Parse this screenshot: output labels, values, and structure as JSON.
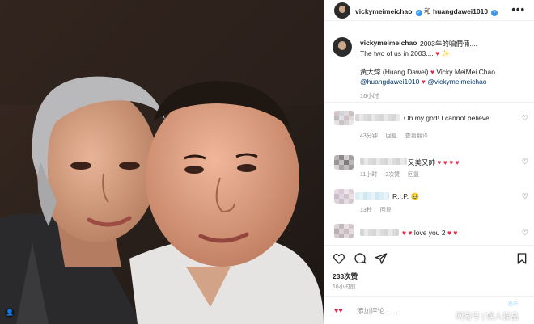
{
  "header": {
    "user1": "vickymeimeichao",
    "conjunction": "和",
    "user2": "huangdawei1010",
    "verified_badge": "✓",
    "more_icon": "more-horizontal-icon",
    "more_glyph": "•••"
  },
  "caption": {
    "username": "vickymeimeichao",
    "text_line1": "2003年的咱們倆....",
    "text_line2": "The two of us in 2003....",
    "heart": "♥",
    "sparkle": "✨",
    "name1": "黃大煒 (Huang Dawei)",
    "name2": "Vicky MeiMei Chao",
    "tag1": "@huangdawei1010",
    "tag2": "@vickymeimeichao",
    "time": "16小时"
  },
  "comments": [
    {
      "text": "Oh my god! I cannot believe",
      "time": "43分钟",
      "reply": "回复",
      "more": "查看翻译"
    },
    {
      "text": "又美又帥",
      "hearts": "♥ ♥ ♥ ♥",
      "time": "11小时",
      "likes": "2次赞",
      "reply": "回复"
    },
    {
      "text": "R.I.P.",
      "emoji": "🥹",
      "time": "13秒",
      "reply": "回复"
    },
    {
      "hearts_left": "♥ ♥",
      "text": "love you 2",
      "hearts_right": "♥ ♥"
    }
  ],
  "actions": {
    "like_icon": "heart-icon",
    "comment_icon": "comment-icon",
    "share_icon": "send-icon",
    "save_icon": "bookmark-icon"
  },
  "likes_count": "233次赞",
  "post_time": "16小时前",
  "add_comment": {
    "hearts": "♥♥",
    "placeholder": "添加评论……",
    "post_button": "发布"
  },
  "watermark": "网易号 | 娱人猫晶",
  "colors": {
    "heart": "#e5294a",
    "link": "#00376b",
    "verified": "#3897f0",
    "muted": "#8e8e8e",
    "post_button": "#b2dffc"
  }
}
